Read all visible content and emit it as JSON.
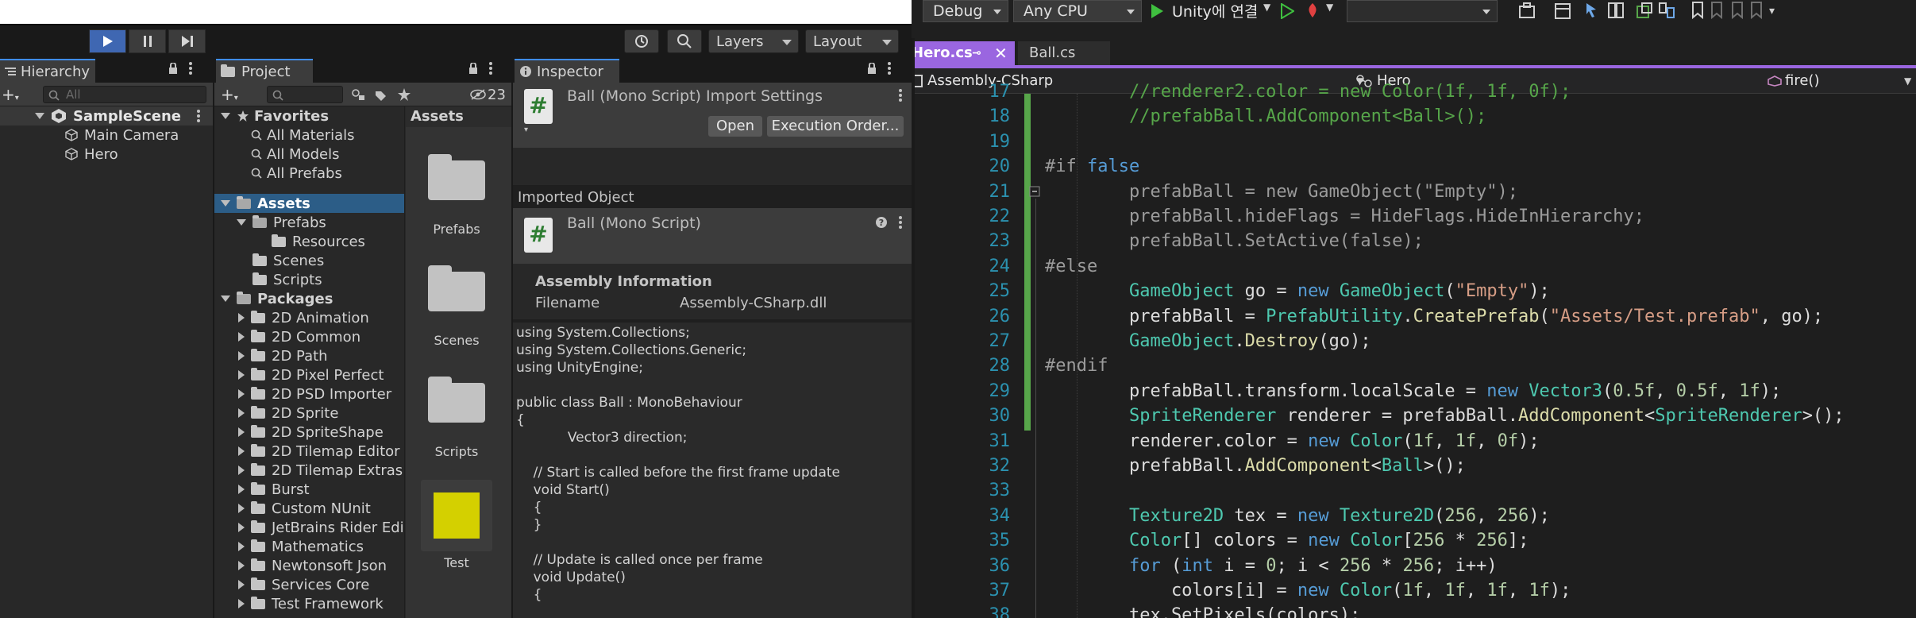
{
  "unity": {
    "toolbar": {
      "play_buttons": [
        "play",
        "pause",
        "step"
      ],
      "layers_label": "Layers",
      "layout_label": "Layout"
    },
    "hierarchy": {
      "tab_label": "Hierarchy",
      "search_placeholder": "All",
      "scene_name": "SampleScene",
      "items": [
        "Main Camera",
        "Hero"
      ]
    },
    "project": {
      "tab_label": "Project",
      "hidden_count": "23",
      "favorites_label": "Favorites",
      "favorites": [
        "All Materials",
        "All Models",
        "All Prefabs"
      ],
      "assets_label": "Assets",
      "assets_children": [
        "Prefabs",
        "Resources",
        "Scenes",
        "Scripts"
      ],
      "packages_label": "Packages",
      "packages": [
        "2D Animation",
        "2D Common",
        "2D Path",
        "2D Pixel Perfect",
        "2D PSD Importer",
        "2D Sprite",
        "2D SpriteShape",
        "2D Tilemap Editor",
        "2D Tilemap Extras",
        "Burst",
        "Custom NUnit",
        "JetBrains Rider Edi",
        "Mathematics",
        "Newtonsoft Json",
        "Services Core",
        "Test Framework"
      ],
      "grid_header": "Assets",
      "grid_items": [
        "Prefabs",
        "Scenes",
        "Scripts",
        "Test"
      ],
      "test_color": "#d4d000"
    },
    "inspector": {
      "tab_label": "Inspector",
      "title": "Ball (Mono Script) Import Settings",
      "open_button": "Open",
      "exec_order_button": "Execution Order...",
      "imported_object_label": "Imported Object",
      "object_name": "Ball (Mono Script)",
      "assembly_info_label": "Assembly Information",
      "filename_label": "Filename",
      "filename_value": "Assembly-CSharp.dll",
      "code_preview": "using System.Collections;\nusing System.Collections.Generic;\nusing UnityEngine;\n\npublic class Ball : MonoBehaviour\n{\n            Vector3 direction;\n\n    // Start is called before the first frame update\n    void Start()\n    {\n    }\n\n    // Update is called once per frame\n    void Update()\n    {"
    }
  },
  "vs": {
    "toolbar": {
      "config": "Debug",
      "platform": "Any CPU",
      "run_label": "Unity에 연결"
    },
    "tabs": [
      {
        "label": "Hero.cs",
        "active": true
      },
      {
        "label": "Ball.cs",
        "active": false
      }
    ],
    "nav": {
      "project": "Assembly-CSharp",
      "class": "Hero",
      "member": "fire()"
    },
    "colors": {
      "keyword": "#569cd6",
      "type": "#4ec9b0",
      "string": "#d69d85",
      "number": "#b5cea8",
      "comment": "#57a64a",
      "line_number": "#2b91af",
      "change_bar": "#57a64a"
    },
    "code_lines": [
      {
        "n": "17",
        "t": [
          [
            "cm",
            "        //renderer2.color = new Color(1f, 1f, 0f);"
          ]
        ]
      },
      {
        "n": "18",
        "t": [
          [
            "cm",
            "        //prefabBall.AddComponent<Ball>();"
          ]
        ]
      },
      {
        "n": "19",
        "t": [
          [
            "pl",
            ""
          ]
        ]
      },
      {
        "n": "20",
        "t": [
          [
            "pp",
            "#if "
          ],
          [
            "kw",
            "false"
          ]
        ]
      },
      {
        "n": "21",
        "t": [
          [
            "pp",
            "        prefabBall = new GameObject(\"Empty\");"
          ]
        ]
      },
      {
        "n": "22",
        "t": [
          [
            "pp",
            "        prefabBall.hideFlags = HideFlags.HideInHierarchy;"
          ]
        ]
      },
      {
        "n": "23",
        "t": [
          [
            "pp",
            "        prefabBall.SetActive(false);"
          ]
        ]
      },
      {
        "n": "24",
        "t": [
          [
            "pp",
            "#else"
          ]
        ]
      },
      {
        "n": "25",
        "t": [
          [
            "pl",
            "        "
          ],
          [
            "ty",
            "GameObject"
          ],
          [
            "pl",
            " go = "
          ],
          [
            "kw",
            "new "
          ],
          [
            "ty",
            "GameObject"
          ],
          [
            "pl",
            "("
          ],
          [
            "st",
            "\"Empty\""
          ],
          [
            "pl",
            ");"
          ]
        ]
      },
      {
        "n": "26",
        "t": [
          [
            "pl",
            "        prefabBall = "
          ],
          [
            "ty",
            "PrefabUtility"
          ],
          [
            "pl",
            "."
          ],
          [
            "fn",
            "CreatePrefab"
          ],
          [
            "pl",
            "("
          ],
          [
            "st",
            "\"Assets/Test.prefab\""
          ],
          [
            "pl",
            ", go);"
          ]
        ]
      },
      {
        "n": "27",
        "t": [
          [
            "pl",
            "        "
          ],
          [
            "ty",
            "GameObject"
          ],
          [
            "pl",
            "."
          ],
          [
            "fn",
            "Destroy"
          ],
          [
            "pl",
            "(go);"
          ]
        ]
      },
      {
        "n": "28",
        "t": [
          [
            "pp",
            "#endif"
          ]
        ]
      },
      {
        "n": "29",
        "t": [
          [
            "pl",
            "        prefabBall.transform.localScale = "
          ],
          [
            "kw",
            "new "
          ],
          [
            "ty",
            "Vector3"
          ],
          [
            "pl",
            "("
          ],
          [
            "nu",
            "0.5f"
          ],
          [
            "pl",
            ", "
          ],
          [
            "nu",
            "0.5f"
          ],
          [
            "pl",
            ", "
          ],
          [
            "nu",
            "1f"
          ],
          [
            "pl",
            ");"
          ]
        ]
      },
      {
        "n": "30",
        "t": [
          [
            "pl",
            "        "
          ],
          [
            "ty",
            "SpriteRenderer"
          ],
          [
            "pl",
            " renderer = prefabBall."
          ],
          [
            "fn",
            "AddComponent"
          ],
          [
            "pl",
            "<"
          ],
          [
            "ty",
            "SpriteRenderer"
          ],
          [
            "pl",
            ">();"
          ]
        ]
      },
      {
        "n": "31",
        "t": [
          [
            "pl",
            "        renderer.color = "
          ],
          [
            "kw",
            "new "
          ],
          [
            "ty",
            "Color"
          ],
          [
            "pl",
            "("
          ],
          [
            "nu",
            "1f"
          ],
          [
            "pl",
            ", "
          ],
          [
            "nu",
            "1f"
          ],
          [
            "pl",
            ", "
          ],
          [
            "nu",
            "0f"
          ],
          [
            "pl",
            ");"
          ]
        ]
      },
      {
        "n": "32",
        "t": [
          [
            "pl",
            "        prefabBall."
          ],
          [
            "fn",
            "AddComponent"
          ],
          [
            "pl",
            "<"
          ],
          [
            "ty",
            "Ball"
          ],
          [
            "pl",
            ">();"
          ]
        ]
      },
      {
        "n": "33",
        "t": [
          [
            "pl",
            ""
          ]
        ]
      },
      {
        "n": "34",
        "t": [
          [
            "pl",
            "        "
          ],
          [
            "ty",
            "Texture2D"
          ],
          [
            "pl",
            " tex = "
          ],
          [
            "kw",
            "new "
          ],
          [
            "ty",
            "Texture2D"
          ],
          [
            "pl",
            "("
          ],
          [
            "nu",
            "256"
          ],
          [
            "pl",
            ", "
          ],
          [
            "nu",
            "256"
          ],
          [
            "pl",
            ");"
          ]
        ]
      },
      {
        "n": "35",
        "t": [
          [
            "pl",
            "        "
          ],
          [
            "ty",
            "Color"
          ],
          [
            "pl",
            "[] colors = "
          ],
          [
            "kw",
            "new "
          ],
          [
            "ty",
            "Color"
          ],
          [
            "pl",
            "["
          ],
          [
            "nu",
            "256"
          ],
          [
            "pl",
            " * "
          ],
          [
            "nu",
            "256"
          ],
          [
            "pl",
            "];"
          ]
        ]
      },
      {
        "n": "36",
        "t": [
          [
            "pl",
            "        "
          ],
          [
            "kw",
            "for"
          ],
          [
            "pl",
            " ("
          ],
          [
            "kw",
            "int"
          ],
          [
            "pl",
            " i = "
          ],
          [
            "nu",
            "0"
          ],
          [
            "pl",
            "; i < "
          ],
          [
            "nu",
            "256"
          ],
          [
            "pl",
            " * "
          ],
          [
            "nu",
            "256"
          ],
          [
            "pl",
            "; i++)"
          ]
        ]
      },
      {
        "n": "37",
        "t": [
          [
            "pl",
            "            colors[i] = "
          ],
          [
            "kw",
            "new "
          ],
          [
            "ty",
            "Color"
          ],
          [
            "pl",
            "("
          ],
          [
            "nu",
            "1f"
          ],
          [
            "pl",
            ", "
          ],
          [
            "nu",
            "1f"
          ],
          [
            "pl",
            ", "
          ],
          [
            "nu",
            "1f"
          ],
          [
            "pl",
            ", "
          ],
          [
            "nu",
            "1f"
          ],
          [
            "pl",
            ");"
          ]
        ]
      },
      {
        "n": "38",
        "t": [
          [
            "pl",
            "        tex.SetPixels(colors);"
          ]
        ]
      }
    ]
  }
}
